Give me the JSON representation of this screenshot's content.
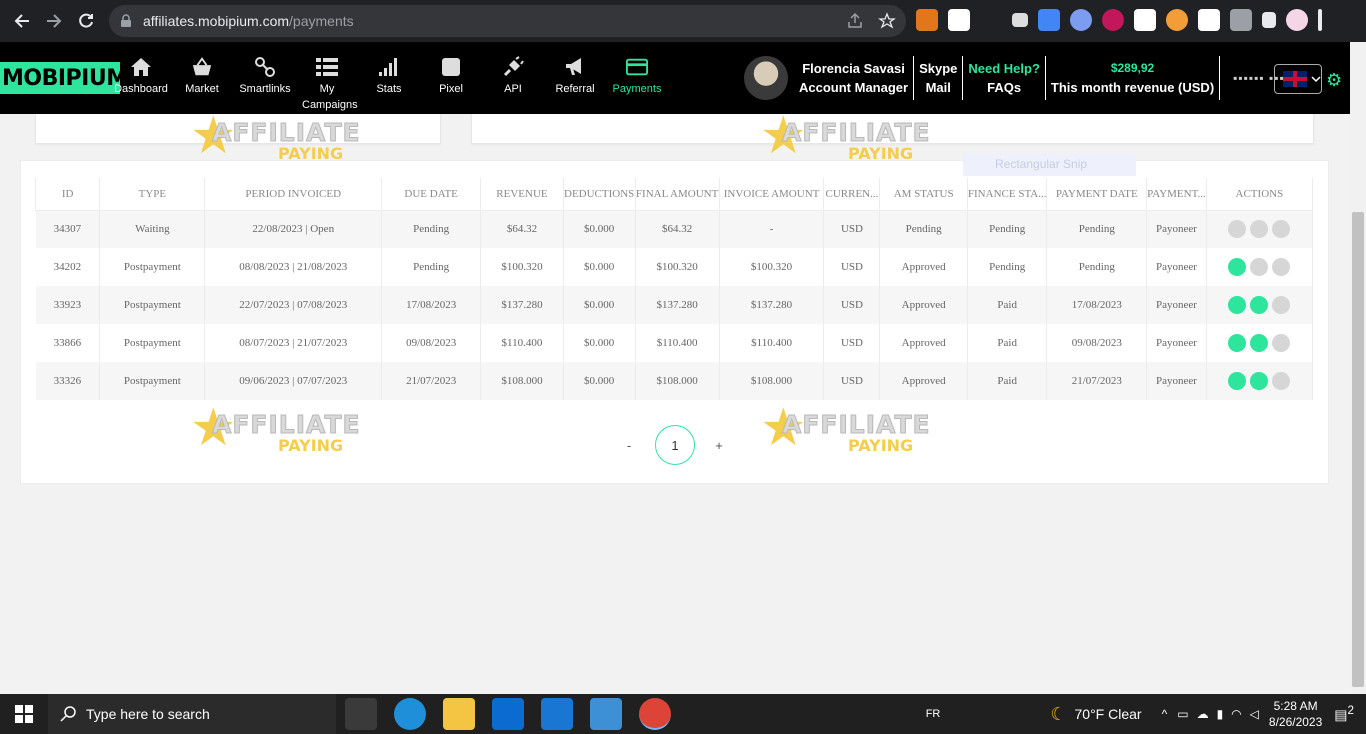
{
  "browser": {
    "url_host": "affiliates.mobipium.com",
    "url_path": "/payments"
  },
  "header": {
    "logo": "MOBIPIUM",
    "menu": [
      {
        "label": "Dashboard",
        "icon": "home-icon"
      },
      {
        "label": "Market",
        "icon": "basket-icon"
      },
      {
        "label": "Smartlinks",
        "icon": "link-icon"
      },
      {
        "label": "My Campaigns",
        "icon": "list-icon"
      },
      {
        "label": "Stats",
        "icon": "bar-chart-icon"
      },
      {
        "label": "Pixel",
        "icon": "pixel-icon"
      },
      {
        "label": "API",
        "icon": "plug-icon"
      },
      {
        "label": "Referral",
        "icon": "megaphone-icon"
      },
      {
        "label": "Payments",
        "icon": "card-icon",
        "active": true
      }
    ],
    "manager_name": "Florencia Savasi",
    "manager_role": "Account Manager",
    "skype": "Skype",
    "mail": "Mail",
    "help": "Need Help?",
    "faqs": "FAQs",
    "revenue_value": "$289,92",
    "revenue_label": "This month revenue (USD)"
  },
  "snip_label": "Rectangular Snip",
  "table": {
    "headers": [
      "ID",
      "TYPE",
      "PERIOD INVOICED",
      "DUE DATE",
      "REVENUE",
      "DEDUCTIONS",
      "FINAL AMOUNT",
      "INVOICE AMOUNT",
      "CURREN...",
      "AM STATUS",
      "FINANCE STA...",
      "PAYMENT DATE",
      "PAYMENT...",
      "ACTIONS"
    ],
    "rows": [
      {
        "id": "34307",
        "type": "Waiting",
        "period": "22/08/2023 | Open",
        "due": "Pending",
        "revenue": "$64.32",
        "deductions": "$0.000",
        "final": "$64.32",
        "invoice": "-",
        "currency": "USD",
        "am": "Pending",
        "finance": "Pending",
        "paydate": "Pending",
        "method": "Payoneer",
        "actions": [
          "off",
          "off",
          "off"
        ]
      },
      {
        "id": "34202",
        "type": "Postpayment",
        "period": "08/08/2023 | 21/08/2023",
        "due": "Pending",
        "revenue": "$100.320",
        "deductions": "$0.000",
        "final": "$100.320",
        "invoice": "$100.320",
        "currency": "USD",
        "am": "Approved",
        "finance": "Pending",
        "paydate": "Pending",
        "method": "Payoneer",
        "actions": [
          "on",
          "off",
          "off"
        ]
      },
      {
        "id": "33923",
        "type": "Postpayment",
        "period": "22/07/2023 | 07/08/2023",
        "due": "17/08/2023",
        "revenue": "$137.280",
        "deductions": "$0.000",
        "final": "$137.280",
        "invoice": "$137.280",
        "currency": "USD",
        "am": "Approved",
        "finance": "Paid",
        "paydate": "17/08/2023",
        "method": "Payoneer",
        "actions": [
          "on",
          "on",
          "off"
        ]
      },
      {
        "id": "33866",
        "type": "Postpayment",
        "period": "08/07/2023 | 21/07/2023",
        "due": "09/08/2023",
        "revenue": "$110.400",
        "deductions": "$0.000",
        "final": "$110.400",
        "invoice": "$110.400",
        "currency": "USD",
        "am": "Approved",
        "finance": "Paid",
        "paydate": "09/08/2023",
        "method": "Payoneer",
        "actions": [
          "on",
          "on",
          "off"
        ]
      },
      {
        "id": "33326",
        "type": "Postpayment",
        "period": "09/06/2023 | 07/07/2023",
        "due": "21/07/2023",
        "revenue": "$108.000",
        "deductions": "$0.000",
        "final": "$108.000",
        "invoice": "$108.000",
        "currency": "USD",
        "am": "Approved",
        "finance": "Paid",
        "paydate": "21/07/2023",
        "method": "Payoneer",
        "actions": [
          "on",
          "on",
          "off"
        ]
      }
    ]
  },
  "pager": {
    "prev": "-",
    "current": "1",
    "next": "+"
  },
  "watermark": {
    "line1": "AFFILIATE",
    "line2": "PAYING"
  },
  "taskbar": {
    "search_placeholder": "Type here to search",
    "lang": "FR",
    "weather": "70°F  Clear",
    "time": "5:28 AM",
    "date": "8/26/2023",
    "notif_count": "2"
  }
}
